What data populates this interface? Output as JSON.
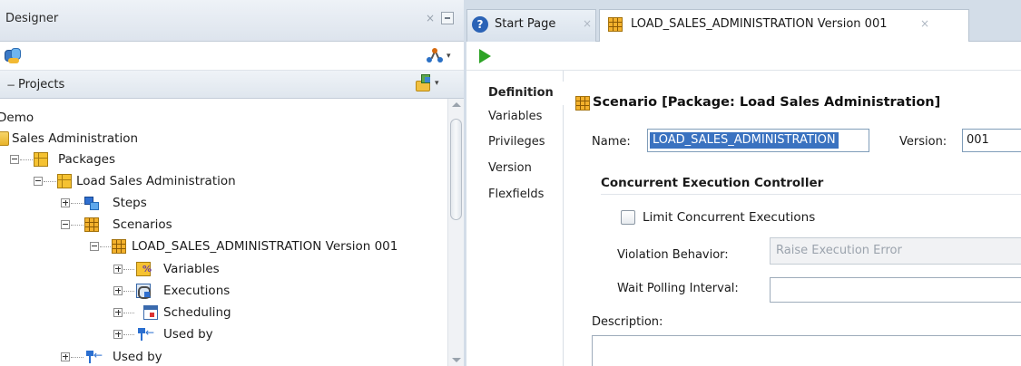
{
  "designer": {
    "title": "Designer",
    "close_glyph": "×",
    "projects_label": "Projects",
    "projects_toggle": "−",
    "model_dropdown_glyph": "▾",
    "new_project_dropdown_glyph": "▾"
  },
  "tree": [
    {
      "label": "Demo",
      "icon": "project-icon"
    },
    {
      "label": "Sales Administration",
      "icon": "folder-icon"
    },
    {
      "label": "Packages",
      "icon": "package-folder-icon"
    },
    {
      "label": "Load Sales Administration",
      "icon": "package-icon"
    },
    {
      "label": "Steps",
      "icon": "steps-icon"
    },
    {
      "label": "Scenarios",
      "icon": "scenarios-icon"
    },
    {
      "label": "LOAD_SALES_ADMINISTRATION Version 001",
      "icon": "scenario-icon"
    },
    {
      "label": "Variables",
      "icon": "variables-icon"
    },
    {
      "label": "Executions",
      "icon": "executions-icon"
    },
    {
      "label": "Scheduling",
      "icon": "scheduling-icon"
    },
    {
      "label": "Used by",
      "icon": "used-by-icon"
    },
    {
      "label": "Used by",
      "icon": "used-by-icon"
    }
  ],
  "editor": {
    "tabs": [
      {
        "label": "Start Page",
        "close": "×",
        "icon": "help-icon",
        "help_glyph": "?"
      },
      {
        "label": "LOAD_SALES_ADMINISTRATION Version 001",
        "close": "×",
        "icon": "scenario-icon"
      }
    ],
    "side_tabs": [
      "Definition",
      "Variables",
      "Privileges",
      "Version",
      "Flexfields"
    ],
    "active_side_tab": "Definition",
    "form": {
      "title": "Scenario [Package: Load Sales Administration]",
      "name_label": "Name:",
      "name_value": "LOAD_SALES_ADMINISTRATION",
      "version_label": "Version:",
      "version_value": "001",
      "cec_title": "Concurrent Execution Controller",
      "limit_label": "Limit Concurrent Executions",
      "limit_checked": false,
      "violation_label": "Violation Behavior:",
      "violation_value": "Raise Execution Error",
      "wait_label": "Wait Polling Interval:",
      "wait_value": "",
      "description_label": "Description:",
      "description_value": ""
    }
  },
  "colors": {
    "selection": "#3a72c0",
    "run_green": "#2da326",
    "chrome": "#d3dde8"
  }
}
